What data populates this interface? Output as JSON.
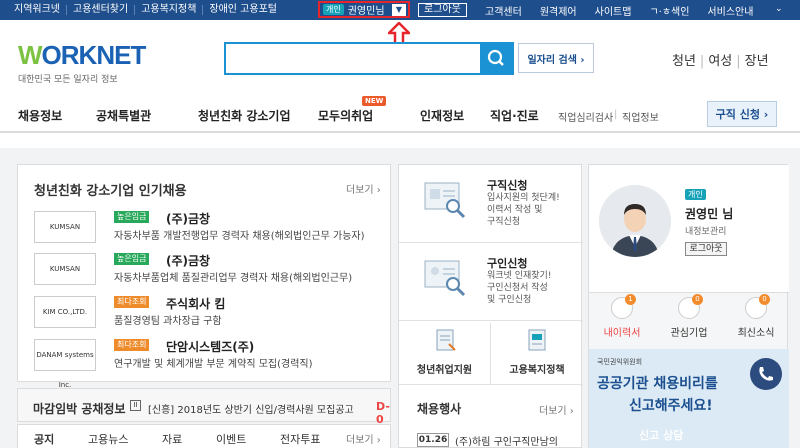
{
  "topbar": {
    "links": [
      "지역워크넷",
      "고용센터찾기",
      "고용복지정책",
      "장애인 고용포털"
    ],
    "user_badge": "개인",
    "user_name": "권영민님",
    "logout": "로그아웃",
    "right_links": [
      "고객센터",
      "원격제어",
      "사이트맵",
      "ㄱ·ㅎ색인",
      "서비스안내"
    ]
  },
  "header": {
    "logo_text": "WORKNET",
    "logo_sub": "대한민국 모든 일자리 정보",
    "search_placeholder": "",
    "job_search_btn": "일자리 검색 ›",
    "age_tabs": [
      "청년",
      "여성",
      "장년"
    ]
  },
  "gnb": {
    "items": [
      "채용정보",
      "공채특별관",
      "청년친화 강소기업",
      "모두의취업",
      "인재정보",
      "직업·진로"
    ],
    "new_badge": "NEW",
    "sub_items": [
      "직업심리검사",
      "직업정보"
    ],
    "apply_btn": "구직 신청 ›"
  },
  "popular": {
    "title": "청년친화 강소기업 인기채용",
    "more": "더보기 ›",
    "jobs": [
      {
        "logo": "KUMSAN",
        "tag": "높은임금",
        "company": "(주)금창",
        "desc": "자동차부품 개발전행업무 경력자 채용(해외법인근무 가능자)"
      },
      {
        "logo": "KUMSAN",
        "tag": "높은임금",
        "company": "(주)금창",
        "desc": "자동차부품업체 품질관리업무 경력자 채용(해외법인근무)"
      },
      {
        "logo": "KIM CO.,LTD.",
        "tag": "최다조회",
        "company": "주식회사 킴",
        "desc": "품질경영팀 과차장급 구함"
      },
      {
        "logo": "DANAM systems Inc.",
        "tag": "최다조회",
        "company": "단암시스템즈(주)",
        "desc": "연구개발 및 체계개발 부문 계약직 모집(경력직)"
      }
    ]
  },
  "deadline": {
    "title": "마감임박 공채정보",
    "pause": "II",
    "item": "[신흥] 2018년도 상반기 신입/경력사원 모집공고",
    "dday": "D-0"
  },
  "notice_tabs": [
    "공지",
    "고용뉴스",
    "자료",
    "이벤트",
    "전자투표"
  ],
  "notice_more": "더보기 ›",
  "services": {
    "seek": {
      "title": "구직신청",
      "desc": [
        "입사지원의 첫단계!",
        "이력서 작성 및",
        "구직신청"
      ]
    },
    "hire": {
      "title": "구인신청",
      "desc": [
        "워크넷 인재찾기!",
        "구인신청서 작성",
        "및 구인신청"
      ]
    },
    "youth": "청년취업지원",
    "welfare": "고용복지정책",
    "events_title": "채용행사",
    "events_more": "더보기 ›",
    "event_date": "01.26",
    "event_text": "(주)하림 구인구직만남의"
  },
  "profile": {
    "badge": "개인",
    "name": "권영민 님",
    "manage": "내정보관리",
    "logout": "로그아웃",
    "stats": [
      {
        "label": "내이력서",
        "count": "1"
      },
      {
        "label": "관심기업",
        "count": "0"
      },
      {
        "label": "최신소식",
        "count": "0"
      }
    ]
  },
  "banner": {
    "org": "국민권익위원회",
    "line1": "공공기관 채용비리를",
    "line2": "신고해주세요!",
    "line3": "신고 상담"
  },
  "colors": {
    "primary": "#1f4e8c",
    "accent": "#1b92d4",
    "highlight": "#e6262a"
  }
}
